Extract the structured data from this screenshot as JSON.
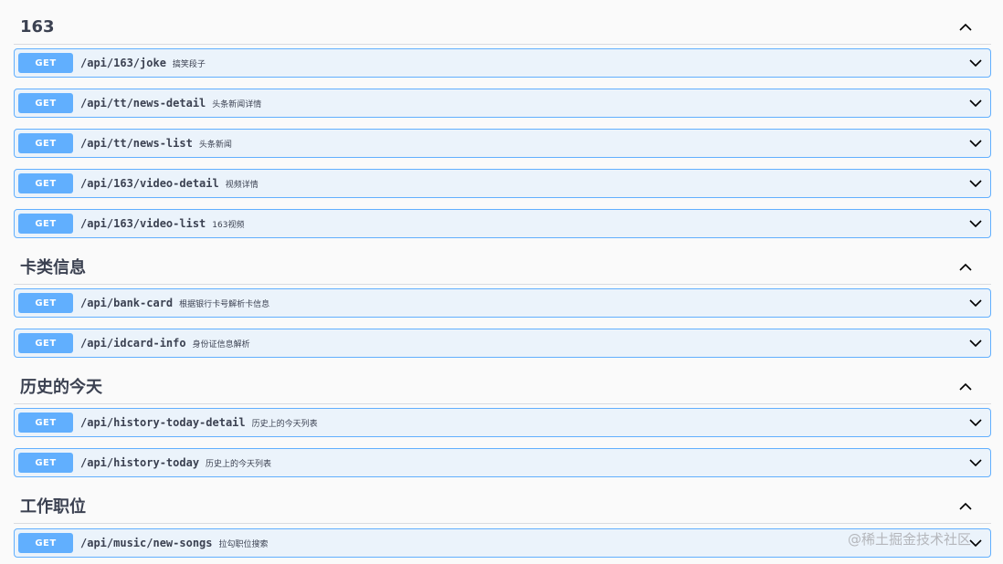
{
  "colors": {
    "get_accent": "#61affe",
    "op_background": "#ebf3fb",
    "text": "#3b4151",
    "page_background": "#fafafa"
  },
  "icons": {
    "expand": "chevron-down-icon",
    "collapse": "chevron-up-icon"
  },
  "sections": [
    {
      "title": "163",
      "operations": [
        {
          "method": "GET",
          "path": "/api/163/joke",
          "summary": "搞笑段子"
        },
        {
          "method": "GET",
          "path": "/api/tt/news-detail",
          "summary": "头条新闻详情"
        },
        {
          "method": "GET",
          "path": "/api/tt/news-list",
          "summary": "头条新闻"
        },
        {
          "method": "GET",
          "path": "/api/163/video-detail",
          "summary": "视频详情"
        },
        {
          "method": "GET",
          "path": "/api/163/video-list",
          "summary": "163视频"
        }
      ]
    },
    {
      "title": "卡类信息",
      "operations": [
        {
          "method": "GET",
          "path": "/api/bank-card",
          "summary": "根据银行卡号解析卡信息"
        },
        {
          "method": "GET",
          "path": "/api/idcard-info",
          "summary": "身份证信息解析"
        }
      ]
    },
    {
      "title": "历史的今天",
      "operations": [
        {
          "method": "GET",
          "path": "/api/history-today-detail",
          "summary": "历史上的今天列表"
        },
        {
          "method": "GET",
          "path": "/api/history-today",
          "summary": "历史上的今天列表"
        }
      ]
    },
    {
      "title": "工作职位",
      "operations": [
        {
          "method": "GET",
          "path": "/api/music/new-songs",
          "summary": "拉勾职位搜索"
        }
      ]
    }
  ],
  "watermark": "@稀土掘金技术社区"
}
